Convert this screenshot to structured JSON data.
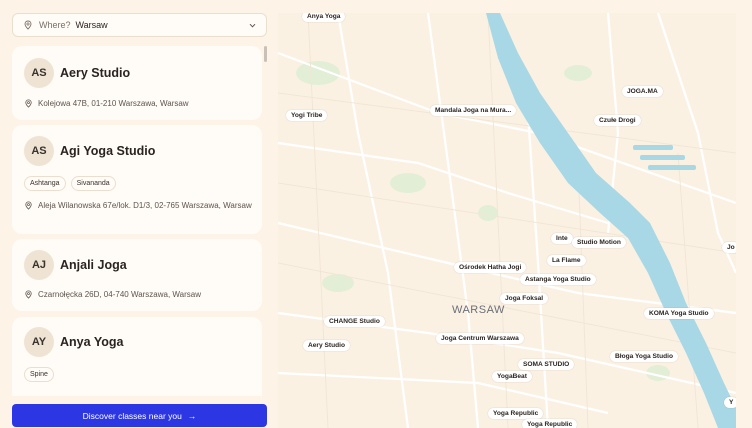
{
  "search": {
    "label": "Where?",
    "value": "Warsaw"
  },
  "studios": [
    {
      "initials": "AS",
      "name": "Aery Studio",
      "tags": [],
      "address": "Kolejowa 47B, 01-210 Warszawa, Warsaw"
    },
    {
      "initials": "AS",
      "name": "Agi Yoga Studio",
      "tags": [
        "Ashtanga",
        "Sivananda"
      ],
      "address": "Aleja Wilanowska 67e/lok. D1/3, 02-765 Warszawa, Warsaw"
    },
    {
      "initials": "AJ",
      "name": "Anjali Joga",
      "tags": [],
      "address": "Czarnołęcka 26D, 04-740 Warszawa, Warsaw"
    },
    {
      "initials": "AY",
      "name": "Anya Yoga",
      "tags": [
        "Spine"
      ],
      "address": ""
    }
  ],
  "cta": {
    "label": "Discover classes near you",
    "arrow": "→"
  },
  "map": {
    "city": "WARSAW",
    "labels": [
      "Anya Yoga",
      "Mandala Joga na Mura...",
      "JOGA.MA",
      "Yogi Tribe",
      "Czułe Drogi",
      "Studio Motion",
      "Inte",
      "La Flame",
      "Ośrodek Hatha Jogi",
      "Astanga Yoga Studio",
      "Joga Foksal",
      "CHANGE Studio",
      "Aery Studio",
      "Joga Centrum Warszawa",
      "KOMA Yoga Studio",
      "SOMA STUDIO",
      "Błoga Yoga Studio",
      "YogaBeat",
      "Yoga Republic",
      "Yoga Republic",
      "Jo",
      "Y"
    ],
    "colors": {
      "water": "#a8d8e6",
      "land": "#fbf1e3",
      "roads": "#ffffff",
      "park": "#e2efd6"
    }
  }
}
